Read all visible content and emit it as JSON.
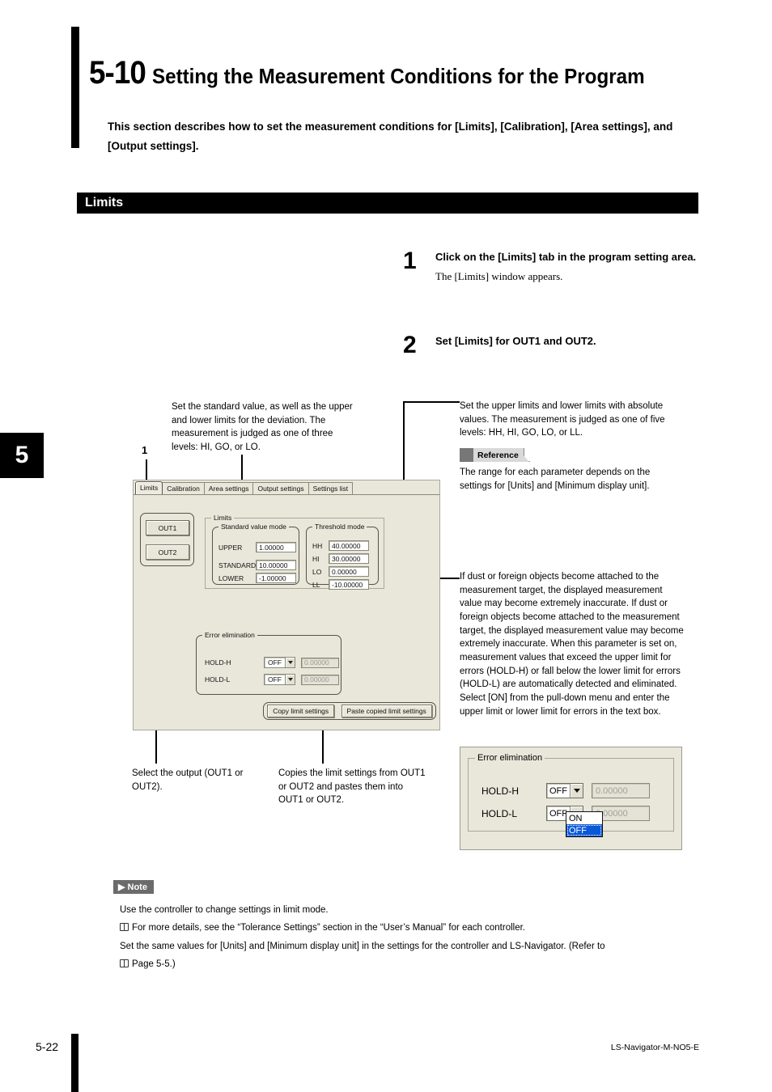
{
  "chapter_tab": "5",
  "header": {
    "number": "5-10",
    "title": "Setting the Measurement Conditions for the Program",
    "intro": "This section describes how to set the measurement conditions for [Limits], [Calibration], [Area settings], and [Output settings]."
  },
  "section": {
    "label": "Limits"
  },
  "steps": [
    {
      "num": "1",
      "title": "Click on the [Limits] tab in the program setting area.",
      "sub": "The [Limits] window appears."
    },
    {
      "num": "2",
      "title": "Set [Limits] for OUT1 and OUT2.",
      "sub": ""
    }
  ],
  "callouts": {
    "marker_1": "1",
    "standard": "Set the standard value, as well as the upper and lower limits for the deviation. The measurement is judged as one of three levels: HI, GO, or LO.",
    "threshold": "Set the upper limits and lower limits with absolute values. The measurement is judged as one of five levels: HH, HI, GO, LO, or LL.",
    "reference_badge": "Reference",
    "reference_body": "The range for each parameter depends on the settings for [Units] and [Minimum display unit].",
    "dust": "If dust or foreign objects become attached to the measurement target, the displayed measurement value may become extremely inaccurate. If dust or foreign objects become attached to the measurement target, the displayed measurement value may become extremely inaccurate. When this parameter is set on, measurement values that exceed the upper limit for errors (HOLD-H) or fall below the lower limit for errors (HOLD-L) are automatically detected and eliminated. Select [ON] from the pull-down menu and enter the upper limit or lower limit for errors in the text box.",
    "caption_output": "Select the output (OUT1 or OUT2).",
    "caption_copy": "Copies the limit settings from OUT1 or OUT2 and pastes them into OUT1 or OUT2."
  },
  "screenshot": {
    "tabs": [
      {
        "label": "Limits",
        "active": true
      },
      {
        "label": "Calibration",
        "active": false
      },
      {
        "label": "Area settings",
        "active": false
      },
      {
        "label": "Output settings",
        "active": false
      },
      {
        "label": "Settings list",
        "active": false
      }
    ],
    "outputs": [
      {
        "label": "OUT1",
        "selected": true
      },
      {
        "label": "OUT2",
        "selected": false
      }
    ],
    "limits_group_label": "Limits",
    "standard_value_mode": {
      "label": "Standard value mode",
      "fields": [
        {
          "name": "UPPER",
          "value": "1.00000"
        },
        {
          "name": "STANDARD",
          "value": "10.00000"
        },
        {
          "name": "LOWER",
          "value": "-1.00000"
        }
      ]
    },
    "threshold_mode": {
      "label": "Threshold mode",
      "fields": [
        {
          "name": "HH",
          "value": "40.00000"
        },
        {
          "name": "HI",
          "value": "30.00000"
        },
        {
          "name": "LO",
          "value": "0.00000"
        },
        {
          "name": "LL",
          "value": "-10.00000"
        }
      ]
    },
    "error_elimination": {
      "label": "Error elimination",
      "rows": [
        {
          "name": "HOLD-H",
          "mode": "OFF",
          "value": "0.00000"
        },
        {
          "name": "HOLD-L",
          "mode": "OFF",
          "value": "0.00000"
        }
      ]
    },
    "buttons": [
      {
        "label": "Copy limit settings"
      },
      {
        "label": "Paste copied limit settings"
      }
    ]
  },
  "detail_panel": {
    "label": "Error elimination",
    "rows": [
      {
        "name": "HOLD-H",
        "mode": "OFF",
        "value": "0.00000"
      },
      {
        "name": "HOLD-L",
        "mode": "OFF",
        "value": "0.00000"
      }
    ],
    "dropdown_options": [
      {
        "label": "ON",
        "selected": false
      },
      {
        "label": "OFF",
        "selected": true
      }
    ]
  },
  "note": {
    "badge": "▶ Note",
    "lines": [
      "Use the controller to change settings in limit mode.",
      "For more details, see the “Tolerance Settings” section in the “User’s Manual” for each controller.",
      "Set the same values for [Units] and [Minimum display unit] in the settings for the controller and LS-Navigator. (Refer to",
      "Page 5-5.)"
    ]
  },
  "footer": {
    "page": "5-22",
    "doc_id": "LS-Navigator-M-NO5-E"
  },
  "colors": {
    "accent_black": "#000000",
    "panel_bg": "#e9e7da",
    "badge_gray": "#6b6b6b",
    "dropdown_highlight": "#0a58d6"
  }
}
